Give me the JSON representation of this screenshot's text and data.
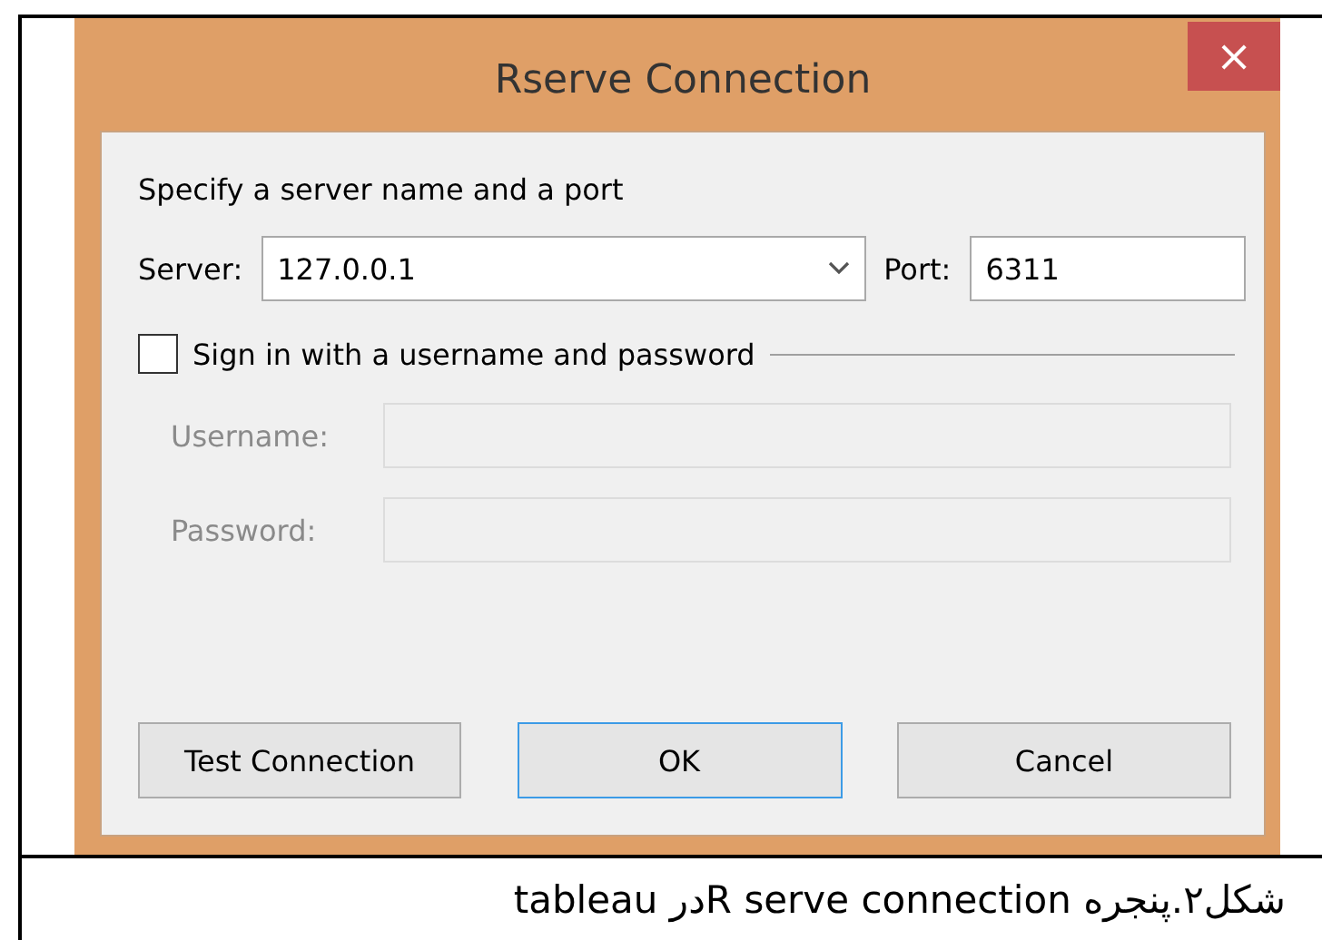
{
  "dialog": {
    "title": "Rserve Connection",
    "close": "×",
    "group_label": "Specify a server name and a port",
    "server": {
      "label": "Server:",
      "value": "127.0.0.1"
    },
    "port": {
      "label": "Port:",
      "value": "6311"
    },
    "sign_in": {
      "label": "Sign in with a username and password",
      "checked": false
    },
    "credentials": [
      {
        "label": "Username:",
        "disabled": true
      },
      {
        "label": "Password:",
        "disabled": true
      }
    ],
    "buttons": [
      {
        "label": "Test Connection",
        "default": false
      },
      {
        "label": "OK",
        "default": true
      },
      {
        "label": "Cancel",
        "default": false
      }
    ]
  },
  "caption": "شکل۲.پنجره  R serve connectionدر tableau"
}
